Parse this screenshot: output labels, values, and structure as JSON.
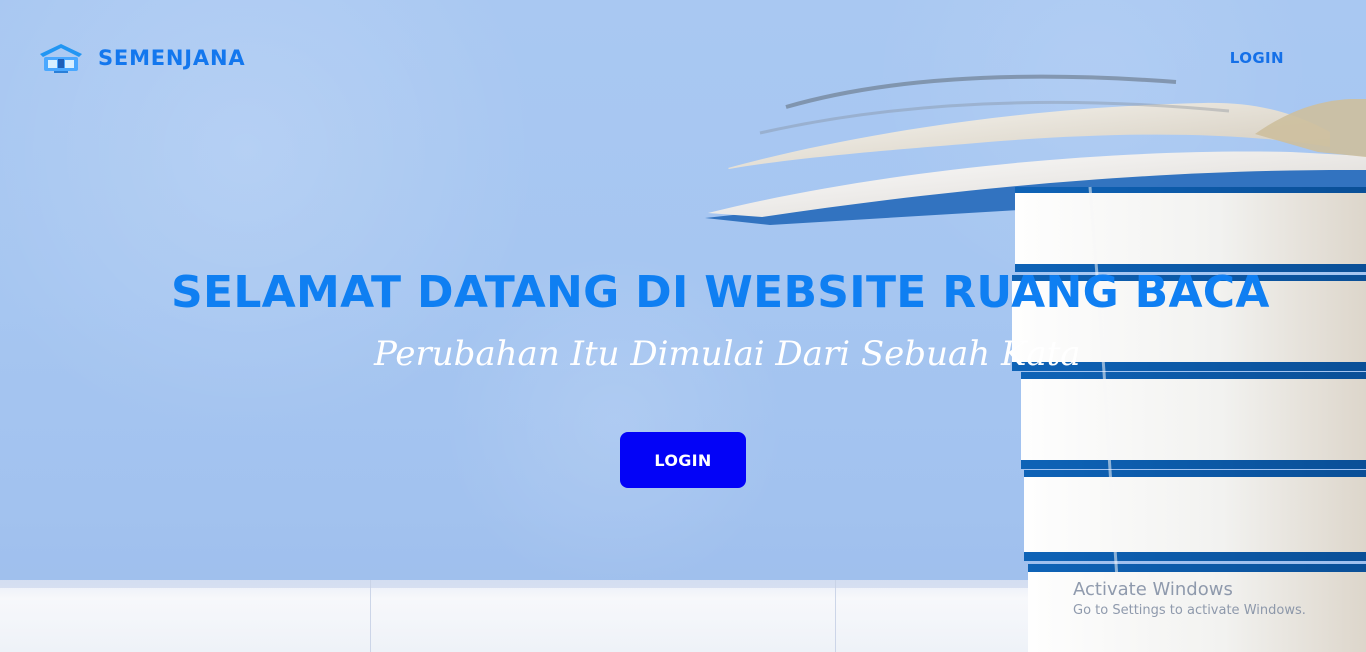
{
  "header": {
    "brand": "SEMENJANA",
    "nav_login": "LOGIN"
  },
  "hero": {
    "title": "SELAMAT DATANG DI WEBSITE RUANG BACA",
    "subtitle": "Perubahan Itu Dimulai Dari Sebuah Kata",
    "button_label": "LOGIN"
  },
  "watermark": {
    "title": "Activate Windows",
    "subtitle": "Go to Settings to activate Windows."
  },
  "colors": {
    "brand": "#1377ee",
    "title": "#0f7ff2",
    "button": "#0303f7",
    "subtitle": "#ffffff"
  },
  "icons": {
    "brand_logo": "library-logo-icon"
  }
}
